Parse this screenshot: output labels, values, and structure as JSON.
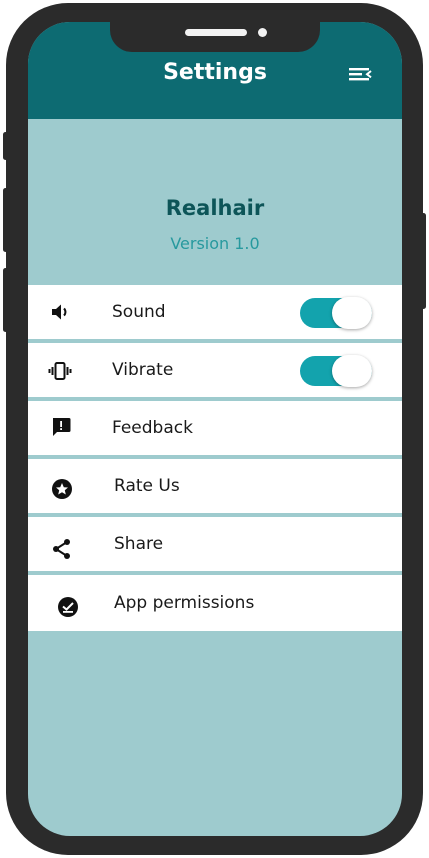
{
  "header": {
    "title": "Settings",
    "menu_icon": "menu-collapse-icon"
  },
  "app": {
    "name": "Realhair",
    "version": "Version 1.0"
  },
  "settings": [
    {
      "label": "Sound",
      "icon": "volume-icon",
      "toggle": true,
      "on": true
    },
    {
      "label": "Vibrate",
      "icon": "vibrate-icon",
      "toggle": true,
      "on": true
    },
    {
      "label": "Feedback",
      "icon": "feedback-icon"
    },
    {
      "label": "Rate Us",
      "icon": "star-circle-icon"
    },
    {
      "label": "Share",
      "icon": "share-icon"
    },
    {
      "label": "App permissions",
      "icon": "permissions-icon"
    }
  ],
  "colors": {
    "header": "#0d6b72",
    "background": "#9ecbce",
    "toggle_on": "#13a3ad",
    "app_name": "#0d5558",
    "version": "#27999e",
    "phone_frame": "#2b2b2b"
  }
}
